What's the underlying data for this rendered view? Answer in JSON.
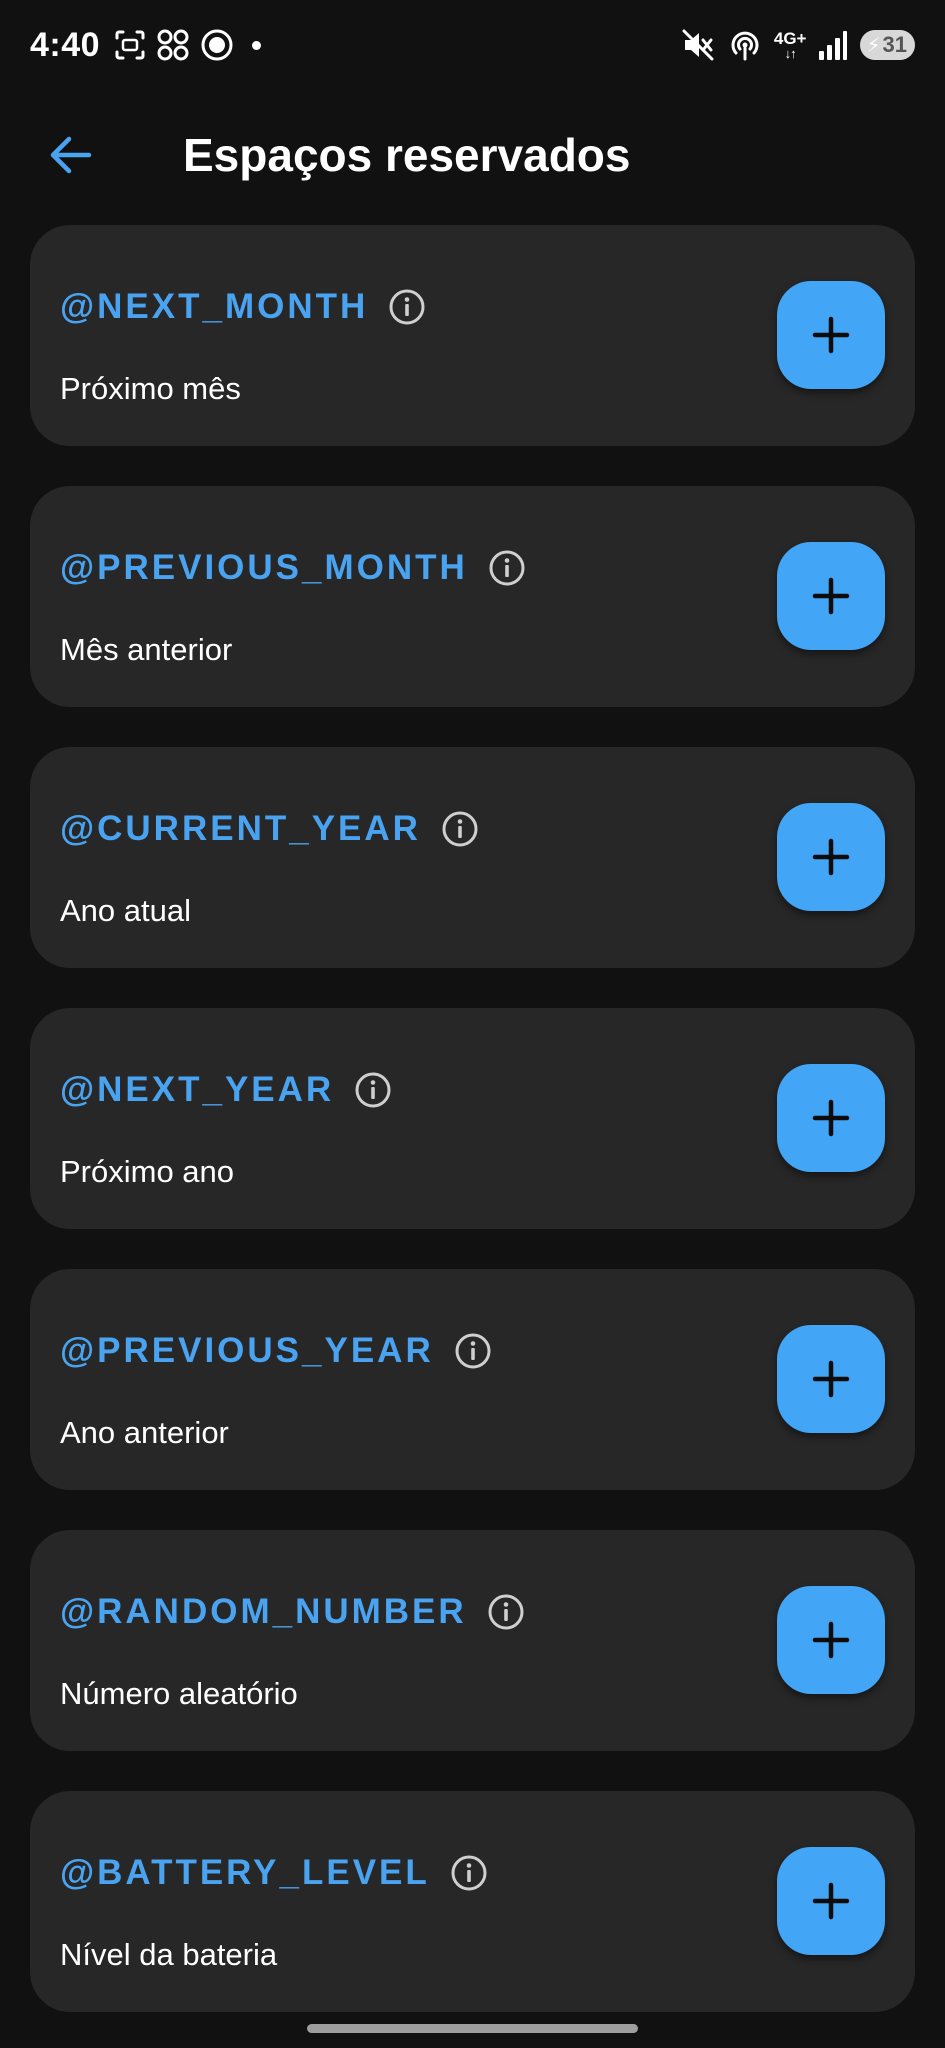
{
  "status_bar": {
    "time": "4:40",
    "network": "4G+",
    "network_arrows": "↓↑",
    "battery_level": "31"
  },
  "header": {
    "title": "Espaços reservados"
  },
  "colors": {
    "accent": "#42a5f5",
    "key_text": "#4aa3f0",
    "card_bg": "#272727",
    "page_bg": "#111111"
  },
  "placeholders": [
    {
      "key": "@NEXT_MONTH",
      "description": "Próximo mês"
    },
    {
      "key": "@PREVIOUS_MONTH",
      "description": "Mês anterior"
    },
    {
      "key": "@CURRENT_YEAR",
      "description": "Ano atual"
    },
    {
      "key": "@NEXT_YEAR",
      "description": "Próximo ano"
    },
    {
      "key": "@PREVIOUS_YEAR",
      "description": "Ano anterior"
    },
    {
      "key": "@RANDOM_NUMBER",
      "description": "Número aleatório"
    },
    {
      "key": "@BATTERY_LEVEL",
      "description": "Nível da bateria"
    }
  ]
}
